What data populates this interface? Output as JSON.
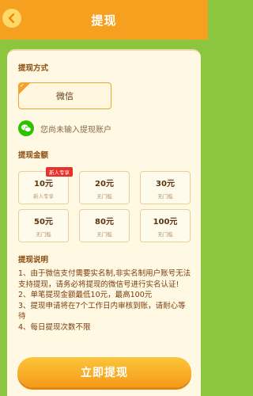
{
  "header": {
    "title": "提现"
  },
  "method": {
    "label": "提现方式",
    "selected": "微信",
    "wechat_hint": "您尚未输入提现账户"
  },
  "amounts": {
    "label": "提现金额",
    "items": [
      {
        "value": "10元",
        "sub": "新人专享",
        "badge": "新人专享"
      },
      {
        "value": "20元",
        "sub": "无门槛"
      },
      {
        "value": "30元",
        "sub": "无门槛"
      },
      {
        "value": "50元",
        "sub": "无门槛"
      },
      {
        "value": "80元",
        "sub": "无门槛"
      },
      {
        "value": "100元",
        "sub": "无门槛"
      }
    ]
  },
  "instructions": {
    "label": "提现说明",
    "lines": [
      "1、由于微信支付需要实名制,非实名制用户账号无法支持提现，请务必将提现的微信号进行实名认证!",
      "2、单笔提现金额最低10元，最高100元",
      "3、提现申请将在7个工作日内审核到账，请耐心等待",
      "4、每日提现次数不限"
    ]
  },
  "submit": {
    "label": "立即提现"
  },
  "icons": {
    "back": "chevron-left-icon",
    "wechat": "wechat-icon",
    "check": "check-icon"
  },
  "colors": {
    "header": "#f5a01e",
    "background": "#8cc63e",
    "card": "#fff8e2",
    "badge": "#e8312a",
    "wechat": "#2dc100"
  }
}
